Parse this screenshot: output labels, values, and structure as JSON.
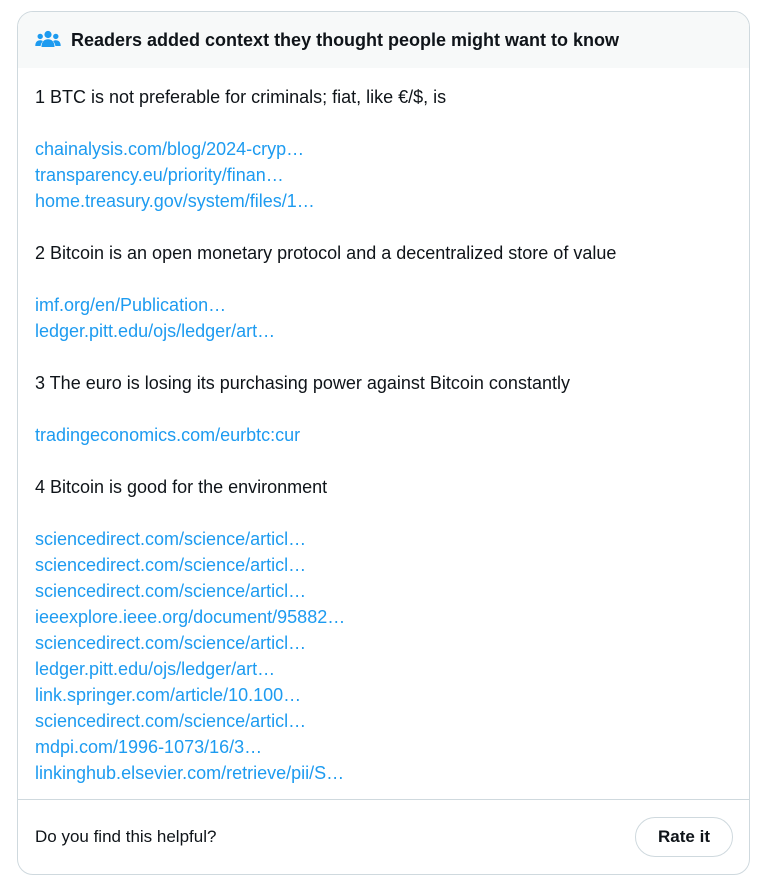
{
  "header": {
    "icon": "people-icon",
    "icon_color": "#1d9bf0",
    "title": "Readers added context they thought people might want to know"
  },
  "notes": [
    {
      "text": "1 BTC is not preferable for criminals; fiat, like €/$, is",
      "links": [
        "chainalysis.com/blog/2024-cryp…",
        "transparency.eu/priority/finan…",
        "home.treasury.gov/system/files/1…"
      ]
    },
    {
      "text": "2 Bitcoin is an open monetary protocol and a decentralized store of value",
      "links": [
        "imf.org/en/Publication…",
        "ledger.pitt.edu/ojs/ledger/art…"
      ]
    },
    {
      "text": "3 The euro is losing its purchasing power against Bitcoin constantly",
      "links": [
        "tradingeconomics.com/eurbtc:cur"
      ]
    },
    {
      "text": "4 Bitcoin is good for the environment",
      "links": [
        "sciencedirect.com/science/articl…",
        "sciencedirect.com/science/articl…",
        "sciencedirect.com/science/articl…",
        "ieeexplore.ieee.org/document/95882…",
        "sciencedirect.com/science/articl…",
        "ledger.pitt.edu/ojs/ledger/art…",
        "link.springer.com/article/10.100…",
        "sciencedirect.com/science/articl…",
        "mdpi.com/1996-1073/16/3…",
        "linkinghub.elsevier.com/retrieve/pii/S…"
      ]
    }
  ],
  "footer": {
    "question": "Do you find this helpful?",
    "rate_label": "Rate it"
  },
  "colors": {
    "link": "#1d9bf0",
    "border": "#cfd9de",
    "header_bg": "#f7f9f9",
    "text": "#0f1419"
  }
}
